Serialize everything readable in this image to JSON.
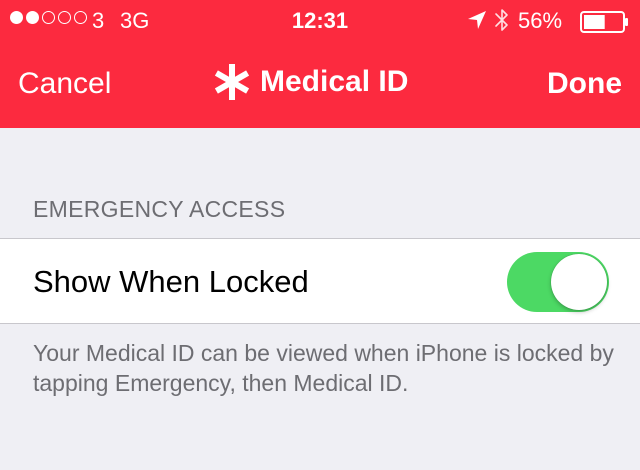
{
  "status_bar": {
    "signal_filled": 2,
    "signal_total": 5,
    "carrier": "3",
    "network": "3G",
    "time": "12:31",
    "battery_percent_text": "56%",
    "battery_level": 0.56,
    "icons": [
      "location-arrow-icon",
      "bluetooth-icon",
      "battery-icon"
    ]
  },
  "nav": {
    "cancel_label": "Cancel",
    "title": "Medical ID",
    "title_icon": "asterisk-icon",
    "done_label": "Done"
  },
  "section": {
    "header": "EMERGENCY ACCESS",
    "row_label": "Show When Locked",
    "toggle_on": true,
    "footer": "Your Medical ID can be viewed when iPhone is locked by tapping Emergency, then Medical ID."
  },
  "colors": {
    "header_red": "#fc2a3f",
    "toggle_green": "#4cd964",
    "background": "#efeff4"
  }
}
